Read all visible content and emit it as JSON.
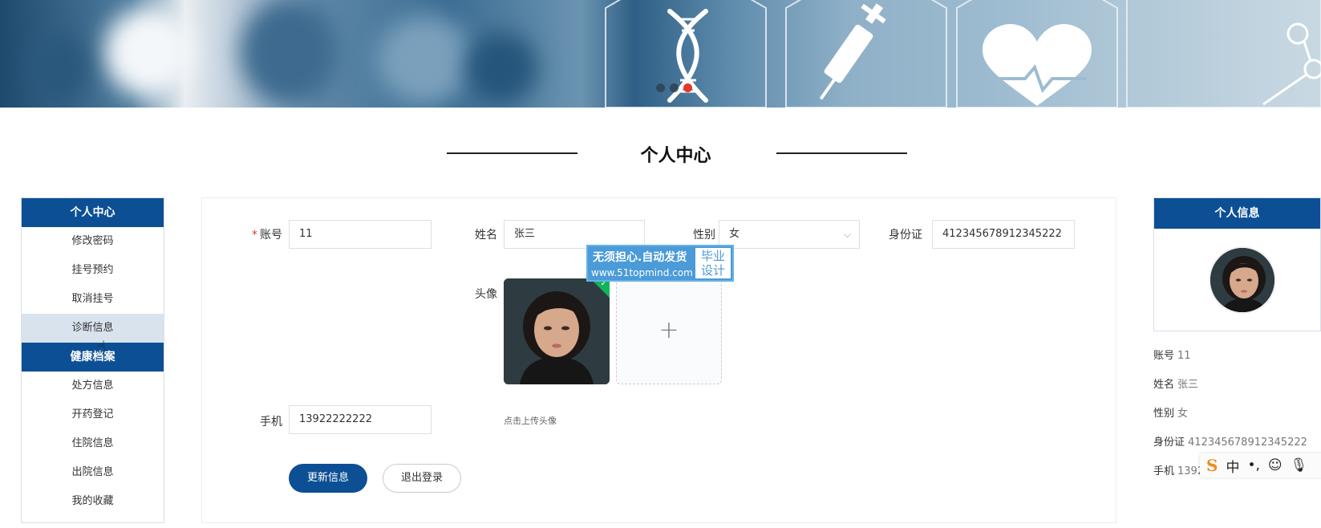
{
  "banner": {
    "carousel_dots": 3,
    "active_dot": 3
  },
  "page_title": "个人中心",
  "left_menu": {
    "sections": [
      {
        "header": "个人中心",
        "items": [
          "修改密码",
          "挂号预约",
          "取消挂号",
          "诊断信息"
        ]
      },
      {
        "header": "健康档案",
        "items": [
          "处方信息",
          "开药登记",
          "住院信息",
          "出院信息",
          "我的收藏"
        ]
      }
    ]
  },
  "form": {
    "account": {
      "label": "账号",
      "value": "11"
    },
    "name": {
      "label": "姓名",
      "value": "张三"
    },
    "gender": {
      "label": "性别",
      "value": "女"
    },
    "id_card": {
      "label": "身份证",
      "value": "412345678912345222"
    },
    "avatar": {
      "label": "头像",
      "upload_hint": "点击上传头像"
    },
    "phone": {
      "label": "手机",
      "value": "13922222222"
    },
    "update_button": "更新信息",
    "logout_button": "退出登录"
  },
  "watermark": {
    "line1": "无须担心.自动发货",
    "line2": "www.51topmind.com",
    "badge_top": "毕业",
    "badge_bottom": "设计"
  },
  "right_card": {
    "title": "个人信息",
    "rows": [
      {
        "label": "账号",
        "value": "11"
      },
      {
        "label": "姓名",
        "value": "张三"
      },
      {
        "label": "性别",
        "value": "女"
      },
      {
        "label": "身份证",
        "value": "412345678912345222"
      },
      {
        "label": "手机",
        "value": "1392"
      }
    ]
  },
  "ime_toolbar": {
    "logo": "S",
    "mode": "中",
    "punct": "•,",
    "emoji": "☺",
    "mic": "mic"
  },
  "colors": {
    "primary": "#0c4f95",
    "active_dot": "#e2372b",
    "success": "#13b35b",
    "watermark": "#4a9bd8"
  }
}
